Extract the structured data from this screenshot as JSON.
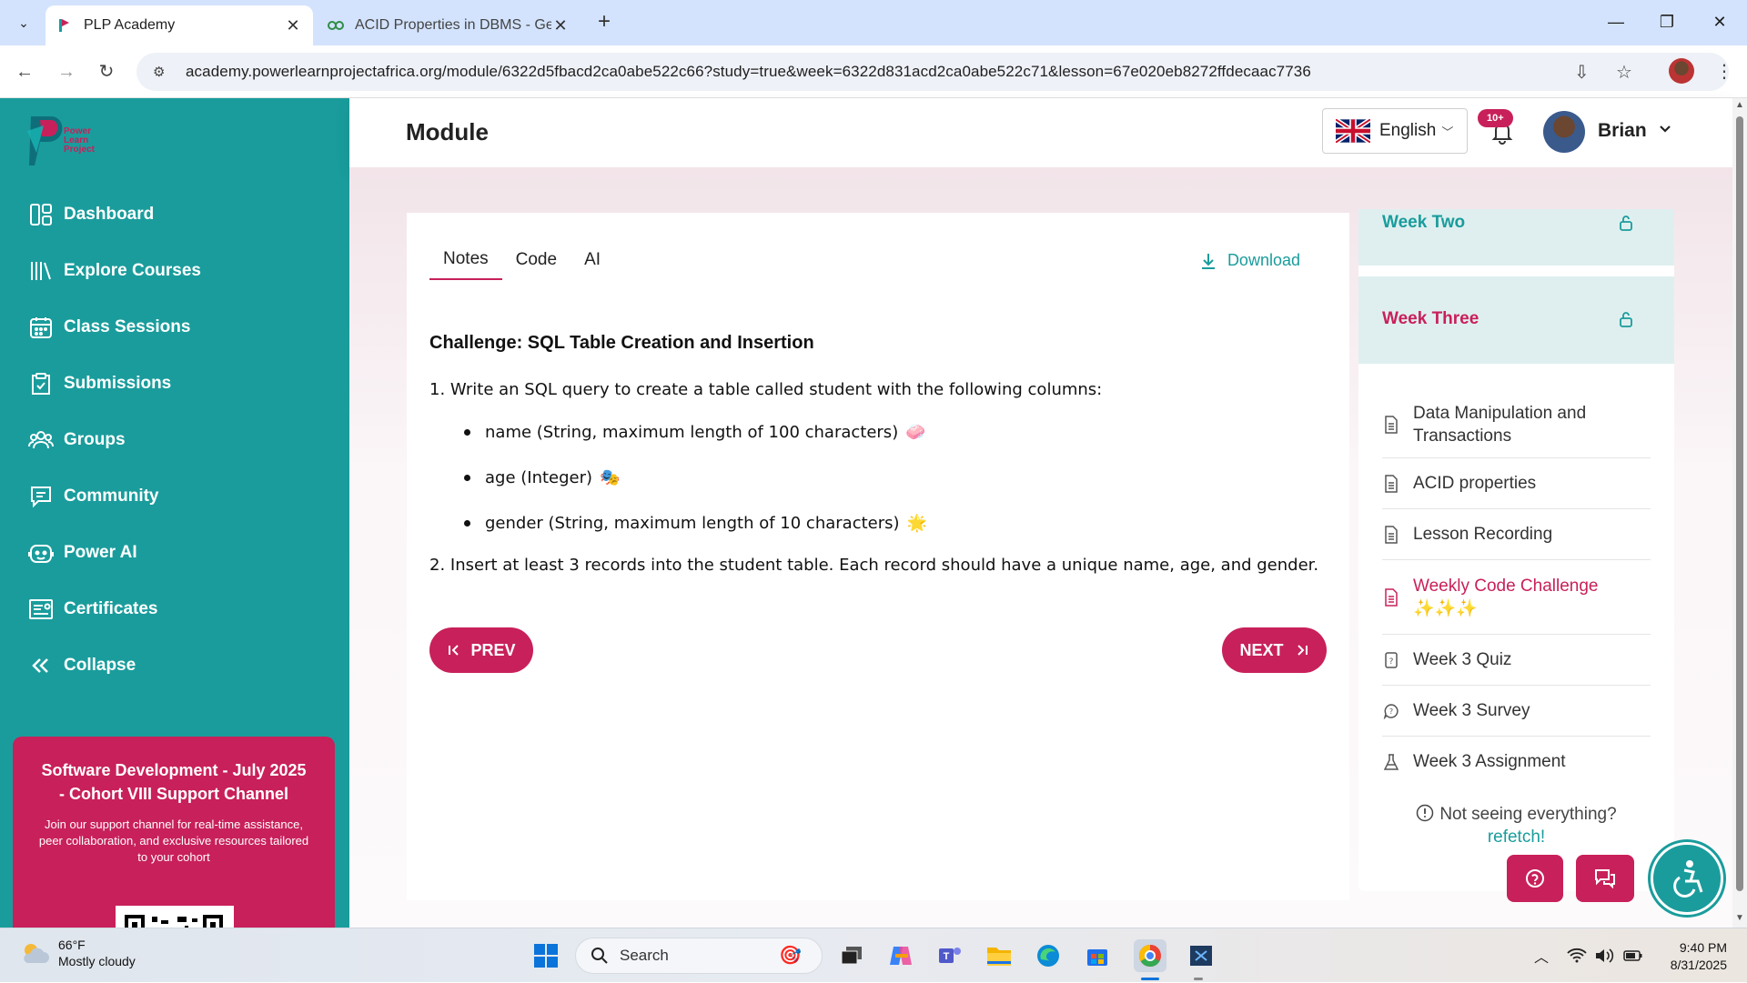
{
  "browser": {
    "tabs": [
      {
        "title": "PLP Academy",
        "active": true
      },
      {
        "title": "ACID Properties in DBMS - Gee",
        "active": false
      }
    ],
    "url": "academy.powerlearnprojectafrica.org/module/6322d5fbacd2ca0abe522c66?study=true&week=6322d831acd2ca0abe522c71&lesson=67e020eb8272ffdecaac7736"
  },
  "brand": {
    "logo_text": [
      "Power",
      "Learn",
      "Project"
    ],
    "primary": "#1a9c9c",
    "accent": "#c8205a"
  },
  "sidebar": {
    "items": [
      {
        "label": "Dashboard",
        "icon": "dashboard-icon"
      },
      {
        "label": "Explore Courses",
        "icon": "library-icon"
      },
      {
        "label": "Class Sessions",
        "icon": "calendar-icon"
      },
      {
        "label": "Submissions",
        "icon": "clipboard-icon"
      },
      {
        "label": "Groups",
        "icon": "users-icon"
      },
      {
        "label": "Community",
        "icon": "chat-icon"
      },
      {
        "label": "Power AI",
        "icon": "bot-icon"
      },
      {
        "label": "Certificates",
        "icon": "certificate-icon"
      },
      {
        "label": "Collapse",
        "icon": "double-chevron-left-icon"
      }
    ],
    "promo": {
      "title": "Software Development - July 2025 - Cohort VIII Support Channel",
      "text": "Join our support channel for real-time assistance, peer collaboration, and exclusive resources tailored to your cohort"
    }
  },
  "header": {
    "title": "Module",
    "language": "English",
    "notifications_badge": "10+",
    "user_name": "Brian"
  },
  "content": {
    "tabs": [
      "Notes",
      "Code",
      "AI"
    ],
    "download_label": "Download",
    "challenge_title": "Challenge: SQL Table Creation and Insertion",
    "step1": "1. Write an SQL query to create a table called student with the following columns:",
    "bullets": [
      {
        "text": "name (String, maximum length of 100 characters)",
        "emoji": "🧼"
      },
      {
        "text": "age (Integer)",
        "emoji": "🎭"
      },
      {
        "text": "gender (String, maximum length of 10 characters)",
        "emoji": "🌟"
      }
    ],
    "step2": "2. Insert at least 3 records into the student table. Each record should have a unique name, age, and gender.",
    "prev_label": "PREV",
    "next_label": "NEXT"
  },
  "course_panel": {
    "weeks": [
      {
        "label": "Week Two"
      },
      {
        "label": "Week Three"
      }
    ],
    "lessons": [
      {
        "label": "Data Manipulation and Transactions",
        "icon": "document-icon",
        "active": false
      },
      {
        "label": "ACID properties",
        "icon": "document-icon",
        "active": false
      },
      {
        "label": "Lesson Recording",
        "icon": "document-icon",
        "active": false
      },
      {
        "label": "Weekly Code Challenge ✨✨✨",
        "icon": "document-icon",
        "active": true
      },
      {
        "label": "Week 3 Quiz",
        "icon": "quiz-icon",
        "active": false
      },
      {
        "label": "Week 3 Survey",
        "icon": "survey-icon",
        "active": false
      },
      {
        "label": "Week 3 Assignment",
        "icon": "flask-icon",
        "active": false
      }
    ],
    "refetch_prompt": "Not seeing everything?",
    "refetch_link": "refetch!"
  },
  "taskbar": {
    "weather_temp": "66°F",
    "weather_desc": "Mostly cloudy",
    "search_label": "Search",
    "time": "9:40 PM",
    "date": "8/31/2025"
  }
}
